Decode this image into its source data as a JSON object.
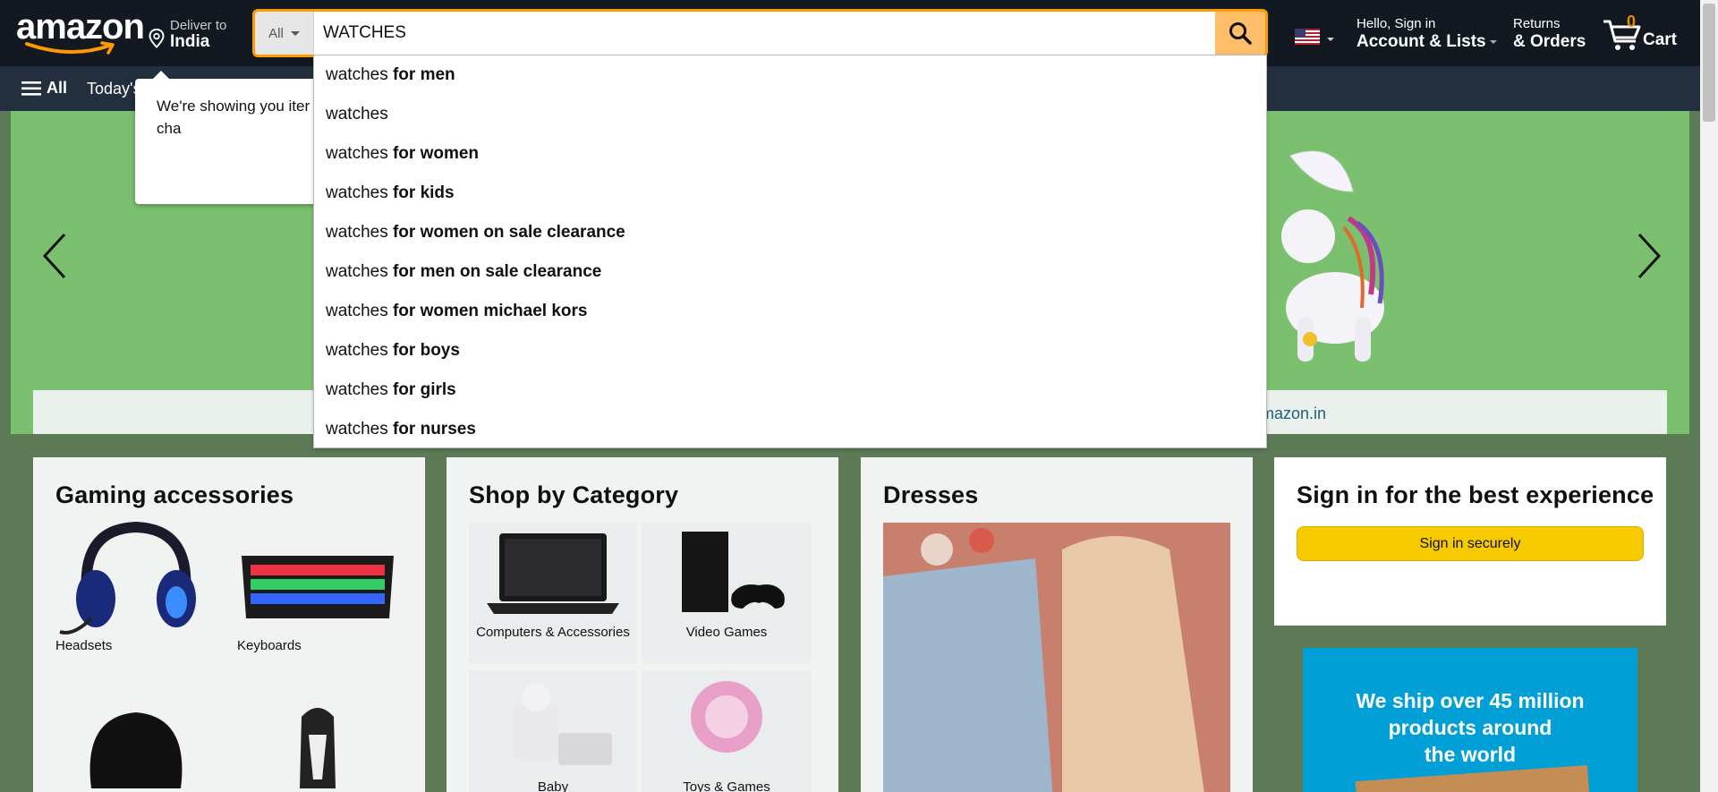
{
  "header": {
    "logo_text": "amazon",
    "deliver_label": "Deliver to",
    "deliver_location": "India",
    "search_category": "All",
    "search_value": "WATCHES",
    "account_greeting": "Hello, Sign in",
    "account_label": "Account & Lists",
    "returns_label": "Returns",
    "orders_label": "& Orders",
    "cart_count": "0",
    "cart_label": "Cart"
  },
  "subnav": {
    "all_label": "All",
    "deals_label": "Today's"
  },
  "popover": {
    "message": "We're showing you iter a different country, cha"
  },
  "hero": {
    "strip_text": "mazon.in"
  },
  "suggestions": [
    {
      "prefix": "watches",
      "suffix": " for men"
    },
    {
      "prefix": "watches",
      "suffix": ""
    },
    {
      "prefix": "watches",
      "suffix": " for women"
    },
    {
      "prefix": "watches",
      "suffix": " for kids"
    },
    {
      "prefix": "watches",
      "suffix": " for women on sale clearance"
    },
    {
      "prefix": "watches",
      "suffix": " for men on sale clearance"
    },
    {
      "prefix": "watches",
      "suffix": " for women michael kors"
    },
    {
      "prefix": "watches",
      "suffix": " for boys"
    },
    {
      "prefix": "watches",
      "suffix": " for girls"
    },
    {
      "prefix": "watches",
      "suffix": " for nurses"
    }
  ],
  "cards": {
    "gaming": {
      "title": "Gaming accessories",
      "items": [
        "Headsets",
        "Keyboards"
      ]
    },
    "category": {
      "title": "Shop by Category",
      "items": [
        "Computers & Accessories",
        "Video Games",
        "Baby",
        "Toys & Games"
      ]
    },
    "dresses": {
      "title": "Dresses"
    },
    "signin": {
      "title": "Sign in for the best experience",
      "button": "Sign in securely"
    }
  },
  "ship_banner": {
    "line1": "We ship over 45 million",
    "line2": "products around",
    "line3": "the world"
  },
  "colors": {
    "header_bg": "#131921",
    "subnav_bg": "#232f3e",
    "search_border": "#ff9900",
    "search_button": "#febd69",
    "signin_button": "#f7ca00",
    "cart_count": "#f08804"
  },
  "icons": [
    "location-pin-icon",
    "search-icon",
    "us-flag-icon",
    "cart-icon",
    "hamburger-icon",
    "chevron-left-icon",
    "chevron-right-icon"
  ]
}
